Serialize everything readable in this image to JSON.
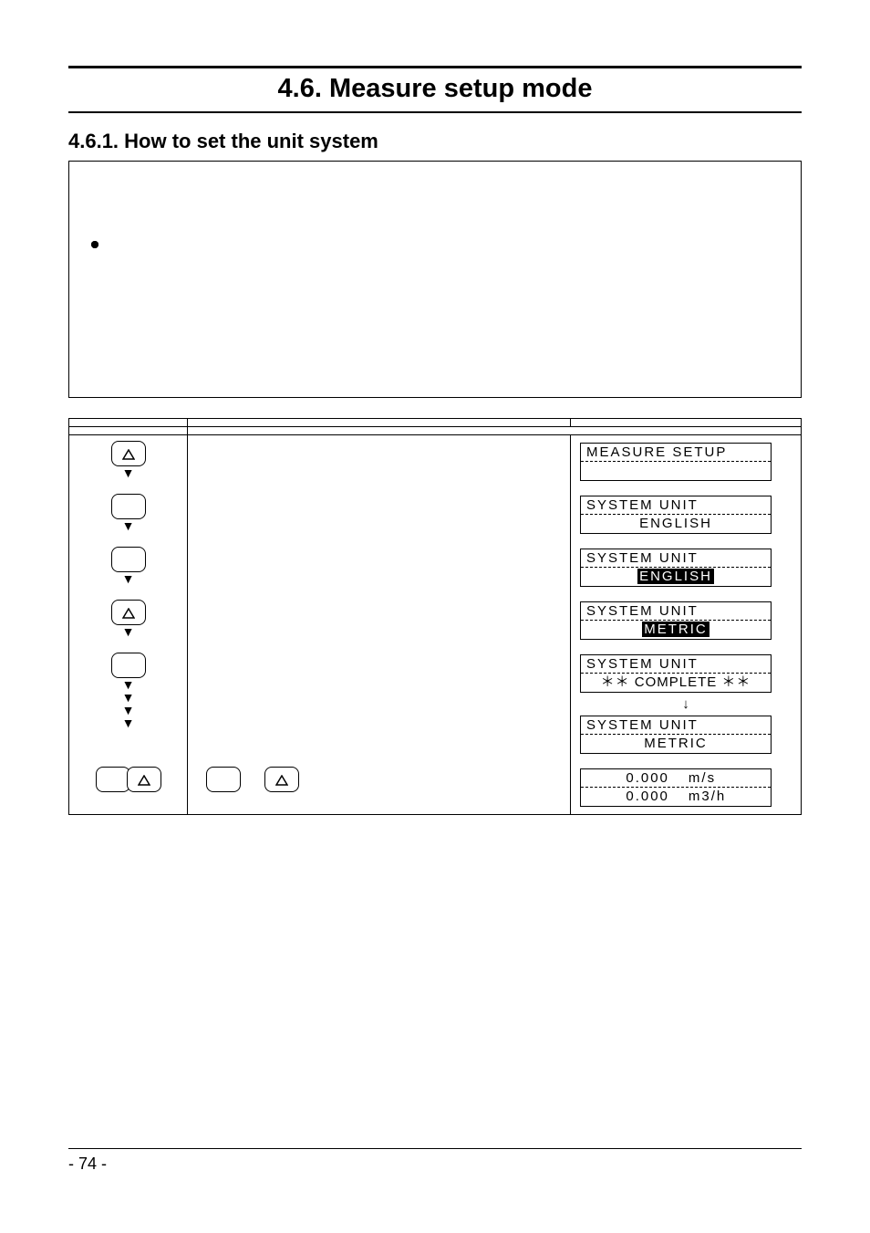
{
  "header": {
    "chapter_title": "4.6. Measure setup mode",
    "section_title": "4.6.1. How to set the unit system"
  },
  "description": {
    "bullets": [
      "",
      "",
      ""
    ]
  },
  "table": {
    "headers": {
      "key": "",
      "operation": "",
      "indication": ""
    },
    "header_row2": {
      "key": "",
      "operation": ""
    },
    "rows": [
      {
        "op": "",
        "screen": {
          "line1": "MEASURE   SETUP",
          "line2": ""
        }
      },
      {
        "op": "",
        "screen": {
          "line1": "SYSTEM   UNIT",
          "line2": "ENGLISH"
        }
      },
      {
        "op": "",
        "screen": {
          "line1": "SYSTEM   UNIT",
          "line2_inv": "ENGLISH"
        }
      },
      {
        "op": "",
        "screen": {
          "line1": "SYSTEM   UNIT",
          "line2_inv": "METRIC"
        }
      },
      {
        "op": "",
        "screen_a": {
          "line1": "SYSTEM   UNIT",
          "line2": "＊＊   COMPLETE   ＊＊"
        },
        "screen_b": {
          "line1": "SYSTEM   UNIT",
          "line2": "METRIC"
        }
      },
      {
        "op_hold": "",
        "op_press": "",
        "screen": {
          "left1": "0.000",
          "right1": "m/s",
          "left2": "0.000",
          "right2": "m3/h"
        }
      }
    ]
  },
  "footer": {
    "page": "- 74 -"
  }
}
